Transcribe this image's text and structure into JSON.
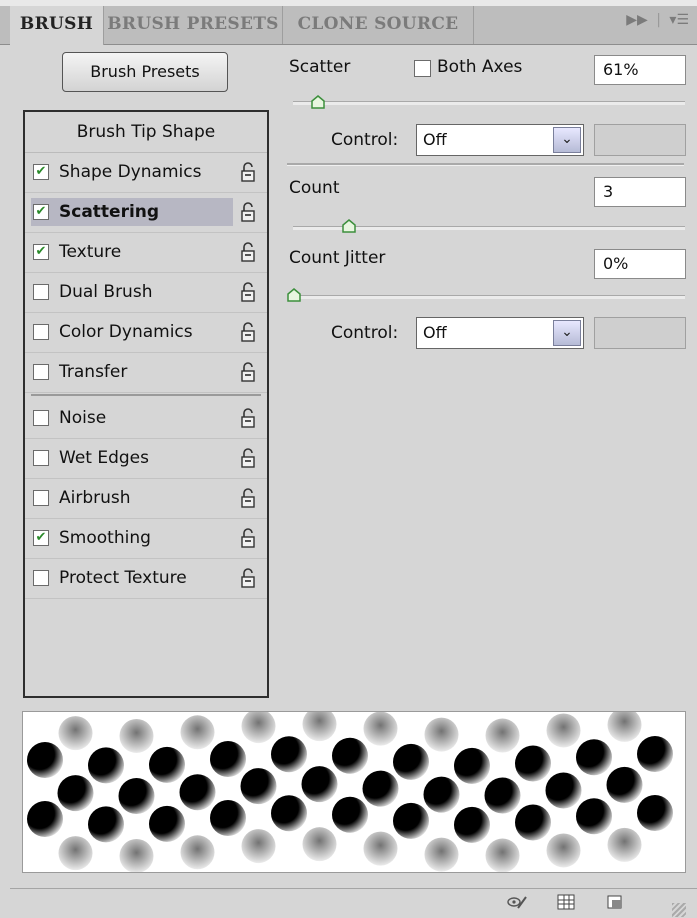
{
  "tabs": [
    {
      "label": "BRUSH",
      "active": true
    },
    {
      "label": "BRUSH PRESETS",
      "active": false
    },
    {
      "label": "CLONE SOURCE",
      "active": false
    }
  ],
  "tabbar_menu_icons": [
    "fast-forward-icon",
    "panel-menu-icon"
  ],
  "brush_presets_button": "Brush Presets",
  "list": {
    "header": "Brush Tip Shape",
    "items": [
      {
        "label": "Shape Dynamics",
        "checked": true,
        "selected": false
      },
      {
        "label": "Scattering",
        "checked": true,
        "selected": true
      },
      {
        "label": "Texture",
        "checked": true,
        "selected": false
      },
      {
        "label": "Dual Brush",
        "checked": false,
        "selected": false
      },
      {
        "label": "Color Dynamics",
        "checked": false,
        "selected": false
      },
      {
        "label": "Transfer",
        "checked": false,
        "selected": false
      },
      {
        "label": "Noise",
        "checked": false,
        "selected": false
      },
      {
        "label": "Wet Edges",
        "checked": false,
        "selected": false
      },
      {
        "label": "Airbrush",
        "checked": false,
        "selected": false
      },
      {
        "label": "Smoothing",
        "checked": true,
        "selected": false
      },
      {
        "label": "Protect Texture",
        "checked": false,
        "selected": false
      }
    ]
  },
  "scatter": {
    "label": "Scatter",
    "both_axes_label": "Both Axes",
    "both_axes_checked": false,
    "value": "61%",
    "slider_fraction": 0.06,
    "control_label": "Control:",
    "control_value": "Off"
  },
  "count": {
    "label": "Count",
    "value": "3",
    "slider_fraction": 0.14
  },
  "count_jitter": {
    "label": "Count Jitter",
    "value": "0%",
    "slider_fraction": 0.0,
    "control_label": "Control:",
    "control_value": "Off"
  },
  "bottom_icons": [
    "visibility-brush-icon",
    "grid-icon",
    "new-preset-icon"
  ],
  "colors": {
    "panel_bg": "#d6d6d6",
    "selected_row": "#b7b7c3",
    "check_green": "#2a8a2a"
  }
}
